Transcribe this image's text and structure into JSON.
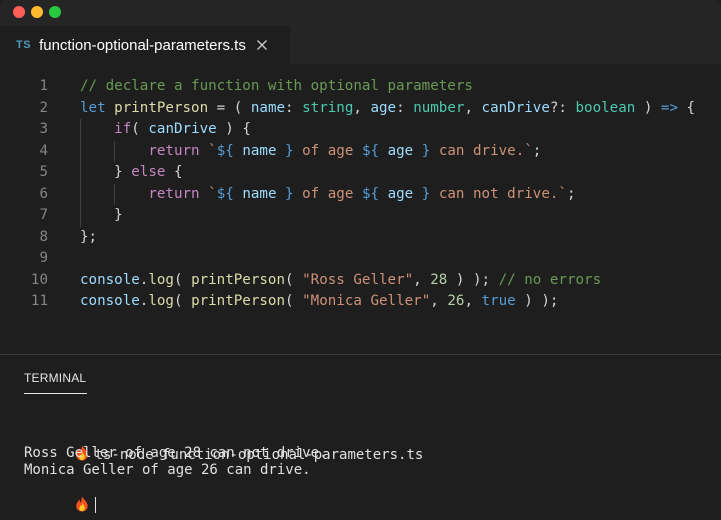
{
  "tab": {
    "lang": "TS",
    "title": "function-optional-parameters.ts"
  },
  "code": {
    "line_numbers": [
      "1",
      "2",
      "3",
      "4",
      "5",
      "6",
      "7",
      "8",
      "9",
      "10",
      "11"
    ],
    "lines": [
      [
        {
          "t": "// declare a function with optional parameters",
          "c": "com"
        }
      ],
      [
        {
          "t": "let",
          "c": "kw"
        },
        {
          "t": " ",
          "c": "pun"
        },
        {
          "t": "printPerson",
          "c": "fn"
        },
        {
          "t": " = ( ",
          "c": "pun"
        },
        {
          "t": "name",
          "c": "var"
        },
        {
          "t": ": ",
          "c": "pun"
        },
        {
          "t": "string",
          "c": "type"
        },
        {
          "t": ", ",
          "c": "pun"
        },
        {
          "t": "age",
          "c": "var"
        },
        {
          "t": ": ",
          "c": "pun"
        },
        {
          "t": "number",
          "c": "type"
        },
        {
          "t": ", ",
          "c": "pun"
        },
        {
          "t": "canDrive",
          "c": "var"
        },
        {
          "t": "?: ",
          "c": "pun"
        },
        {
          "t": "boolean",
          "c": "type"
        },
        {
          "t": " ) ",
          "c": "pun"
        },
        {
          "t": "=>",
          "c": "kw"
        },
        {
          "t": " {",
          "c": "pun"
        }
      ],
      [
        {
          "t": "    ",
          "c": "pun"
        },
        {
          "t": "if",
          "c": "ctl"
        },
        {
          "t": "( ",
          "c": "pun"
        },
        {
          "t": "canDrive",
          "c": "var"
        },
        {
          "t": " ) {",
          "c": "pun"
        }
      ],
      [
        {
          "t": "        ",
          "c": "pun"
        },
        {
          "t": "return",
          "c": "ctl"
        },
        {
          "t": " ",
          "c": "pun"
        },
        {
          "t": "`",
          "c": "str"
        },
        {
          "t": "${",
          "c": "kw"
        },
        {
          "t": " ",
          "c": "pun"
        },
        {
          "t": "name",
          "c": "var"
        },
        {
          "t": " ",
          "c": "pun"
        },
        {
          "t": "}",
          "c": "kw"
        },
        {
          "t": " of age ",
          "c": "str"
        },
        {
          "t": "${",
          "c": "kw"
        },
        {
          "t": " ",
          "c": "pun"
        },
        {
          "t": "age",
          "c": "var"
        },
        {
          "t": " ",
          "c": "pun"
        },
        {
          "t": "}",
          "c": "kw"
        },
        {
          "t": " can drive.`",
          "c": "str"
        },
        {
          "t": ";",
          "c": "pun"
        }
      ],
      [
        {
          "t": "    } ",
          "c": "pun"
        },
        {
          "t": "else",
          "c": "ctl"
        },
        {
          "t": " {",
          "c": "pun"
        }
      ],
      [
        {
          "t": "        ",
          "c": "pun"
        },
        {
          "t": "return",
          "c": "ctl"
        },
        {
          "t": " ",
          "c": "pun"
        },
        {
          "t": "`",
          "c": "str"
        },
        {
          "t": "${",
          "c": "kw"
        },
        {
          "t": " ",
          "c": "pun"
        },
        {
          "t": "name",
          "c": "var"
        },
        {
          "t": " ",
          "c": "pun"
        },
        {
          "t": "}",
          "c": "kw"
        },
        {
          "t": " of age ",
          "c": "str"
        },
        {
          "t": "${",
          "c": "kw"
        },
        {
          "t": " ",
          "c": "pun"
        },
        {
          "t": "age",
          "c": "var"
        },
        {
          "t": " ",
          "c": "pun"
        },
        {
          "t": "}",
          "c": "kw"
        },
        {
          "t": " can not drive.`",
          "c": "str"
        },
        {
          "t": ";",
          "c": "pun"
        }
      ],
      [
        {
          "t": "    }",
          "c": "pun"
        }
      ],
      [
        {
          "t": "};",
          "c": "pun"
        }
      ],
      [],
      [
        {
          "t": "console",
          "c": "var"
        },
        {
          "t": ".",
          "c": "pun"
        },
        {
          "t": "log",
          "c": "fn"
        },
        {
          "t": "( ",
          "c": "pun"
        },
        {
          "t": "printPerson",
          "c": "fn"
        },
        {
          "t": "( ",
          "c": "pun"
        },
        {
          "t": "\"Ross Geller\"",
          "c": "str"
        },
        {
          "t": ", ",
          "c": "pun"
        },
        {
          "t": "28",
          "c": "num"
        },
        {
          "t": " ) ); ",
          "c": "pun"
        },
        {
          "t": "// no errors",
          "c": "com"
        }
      ],
      [
        {
          "t": "console",
          "c": "var"
        },
        {
          "t": ".",
          "c": "pun"
        },
        {
          "t": "log",
          "c": "fn"
        },
        {
          "t": "( ",
          "c": "pun"
        },
        {
          "t": "printPerson",
          "c": "fn"
        },
        {
          "t": "( ",
          "c": "pun"
        },
        {
          "t": "\"Monica Geller\"",
          "c": "str"
        },
        {
          "t": ", ",
          "c": "pun"
        },
        {
          "t": "26",
          "c": "num"
        },
        {
          "t": ", ",
          "c": "pun"
        },
        {
          "t": "true",
          "c": "kw"
        },
        {
          "t": " ) );",
          "c": "pun"
        }
      ]
    ]
  },
  "terminal": {
    "tab_label": "TERMINAL",
    "command": "ts-node function-optional-parameters.ts",
    "output": [
      "Ross Geller of age 28 can not drive.",
      "Monica Geller of age 26 can drive."
    ]
  },
  "colors": {
    "comment": "#6a9955",
    "keyword": "#569cd6",
    "control": "#c586c0",
    "function": "#dcdcaa",
    "variable": "#9cdcfe",
    "type": "#4ec9b0",
    "string": "#ce9178",
    "number": "#b5cea8"
  },
  "icons": {
    "tab_close": "close-icon",
    "prompt": "flame-icon"
  }
}
